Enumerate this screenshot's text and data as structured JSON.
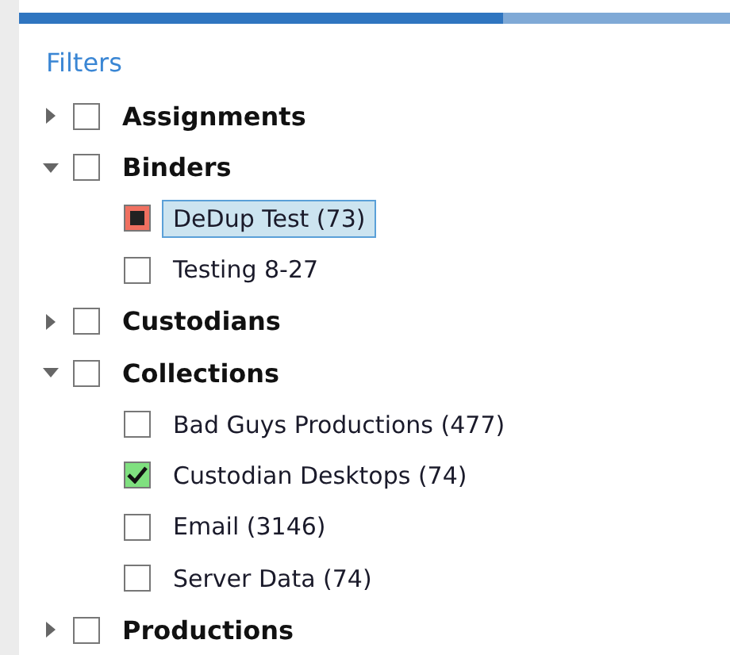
{
  "panel": {
    "title": "Filters"
  },
  "tree": [
    {
      "label": "Assignments",
      "expanded": false,
      "checked": false,
      "excluded": false
    },
    {
      "label": "Binders",
      "expanded": true,
      "checked": false,
      "excluded": false,
      "children": [
        {
          "label": "DeDup Test (73)",
          "checked": false,
          "excluded": true,
          "selected": true
        },
        {
          "label": "Testing 8-27",
          "checked": false,
          "excluded": false,
          "selected": false
        }
      ]
    },
    {
      "label": "Custodians",
      "expanded": false,
      "checked": false,
      "excluded": false
    },
    {
      "label": "Collections",
      "expanded": true,
      "checked": false,
      "excluded": false,
      "children": [
        {
          "label": "Bad Guys Productions (477)",
          "checked": false,
          "excluded": false,
          "selected": false
        },
        {
          "label": "Custodian Desktops (74)",
          "checked": true,
          "excluded": false,
          "selected": false
        },
        {
          "label": "Email (3146)",
          "checked": false,
          "excluded": false,
          "selected": false
        },
        {
          "label": "Server Data (74)",
          "checked": false,
          "excluded": false,
          "selected": false
        }
      ]
    },
    {
      "label": "Productions",
      "expanded": false,
      "checked": false,
      "excluded": false
    }
  ]
}
